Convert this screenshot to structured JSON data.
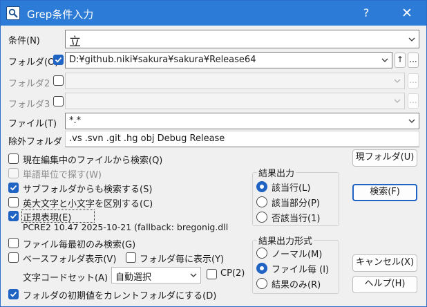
{
  "window": {
    "title": "Grep条件入力",
    "help_label": "?",
    "close_label": "✕"
  },
  "labels": {
    "condition": "条件(N)",
    "folder": "フォルダ(O)",
    "folder2": "フォルダ2",
    "folder3": "フォルダ3",
    "file": "ファイル(T)",
    "exclude": "除外フォルダ"
  },
  "fields": {
    "condition_value": "立",
    "folder_value": "D:¥github.niki¥sakura¥sakura¥Release64",
    "folder2_value": "",
    "folder3_value": "",
    "file_value": "*.*",
    "exclude_value": ".vs .svn .git .hg obj Debug Release",
    "charset_value": "自動選択"
  },
  "small_buttons": {
    "up": "↑",
    "browse": "..."
  },
  "options": {
    "search_current": "現在編集中のファイルから検索(Q)",
    "word_unit": "単語単位で探す(W)",
    "subfolder": "サブフォルダからも検索する(S)",
    "case": "英大文字と小文字を区別する(C)",
    "regex": "正規表現(E)",
    "regex_info": "PCRE2 10.47 2025-10-21 (fallback: bregonig.dll",
    "file_first": "ファイル毎最初のみ検索(G)",
    "base_folder": "ベースフォルダ表示(V)",
    "folder_each": "フォルダ毎に表示(Y)",
    "charset_label": "文字コードセット(A)",
    "cp": "CP(2)",
    "initial_folder": "フォルダの初期値をカレントフォルダにする(D)"
  },
  "states": {
    "search_current": false,
    "word_unit": false,
    "subfolder": true,
    "case": false,
    "regex": true,
    "file_first": false,
    "base_folder": false,
    "folder_each": false,
    "cp": false,
    "initial_folder": true,
    "folder_checkbox": true,
    "folder2_checkbox": false,
    "folder3_checkbox": false
  },
  "result_output": {
    "title": "結果出力",
    "items": [
      "該当行(L)",
      "該当部分(P)",
      "否該当行(1)"
    ],
    "selected": 0
  },
  "result_format": {
    "title": "結果出力形式",
    "items": [
      "ノーマル(M)",
      "ファイル毎 (I)",
      "結果のみ(R)"
    ],
    "selected": 1
  },
  "buttons": {
    "current_folder": "現フォルダ(U)",
    "search": "検索(F)",
    "cancel": "キャンセル(X)",
    "help": "ヘルプ(H)"
  },
  "colors": {
    "titlebar": "#2c7bd6",
    "accent": "#1f63c3",
    "window_bg": "#f0f0f0"
  }
}
